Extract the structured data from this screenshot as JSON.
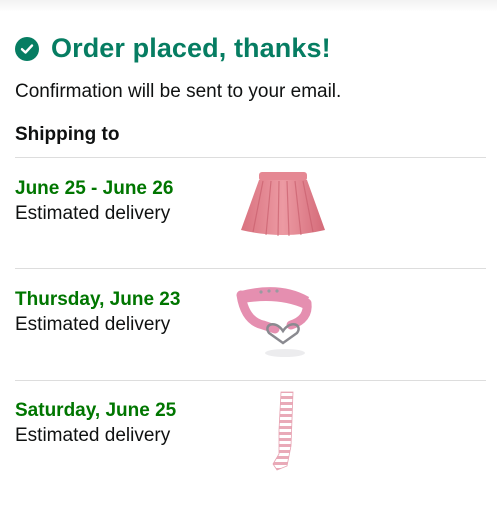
{
  "header": {
    "title": "Order placed, thanks!",
    "icon": "check-circle-icon",
    "accent_color": "#067d62"
  },
  "confirmation_text": "Confirmation will be sent to your email.",
  "shipping_label": "Shipping to",
  "shipments": [
    {
      "date": "June 25 - June 26",
      "status": "Estimated delivery",
      "item_image": "pink-pleated-skirt"
    },
    {
      "date": "Thursday, June 23",
      "status": "Estimated delivery",
      "item_image": "pink-heart-choker"
    },
    {
      "date": "Saturday, June 25",
      "status": "Estimated delivery",
      "item_image": "pink-striped-stocking"
    }
  ],
  "date_color": "#007600"
}
